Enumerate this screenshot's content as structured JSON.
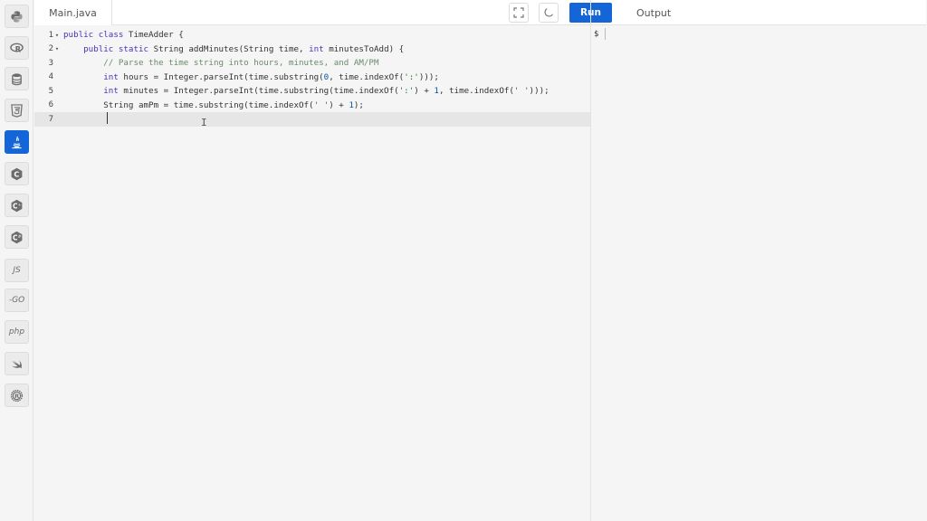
{
  "header": {
    "file_tab": "Main.java",
    "run_label": "Run",
    "output_label": "Output"
  },
  "languages": [
    {
      "name": "python",
      "label": "",
      "icon": "python-icon"
    },
    {
      "name": "r",
      "label": "",
      "icon": "r-icon"
    },
    {
      "name": "sql",
      "label": "",
      "icon": "database-icon"
    },
    {
      "name": "html",
      "label": "",
      "icon": "html5-icon"
    },
    {
      "name": "java",
      "label": "",
      "icon": "java-icon",
      "active": true
    },
    {
      "name": "c",
      "label": "",
      "icon": "c-icon"
    },
    {
      "name": "cpp",
      "label": "",
      "icon": "cpp-icon"
    },
    {
      "name": "csharp",
      "label": "",
      "icon": "csharp-icon"
    },
    {
      "name": "javascript",
      "label": "JS",
      "icon": "js-icon"
    },
    {
      "name": "go",
      "label": "-GO",
      "icon": "go-icon"
    },
    {
      "name": "php",
      "label": "php",
      "icon": "php-icon"
    },
    {
      "name": "swift",
      "label": "",
      "icon": "swift-icon"
    },
    {
      "name": "rust",
      "label": "",
      "icon": "rust-icon"
    }
  ],
  "editor": {
    "line_numbers": [
      "1",
      "2",
      "3",
      "4",
      "5",
      "6",
      "7"
    ],
    "lines": [
      "public class TimeAdder {",
      "    public static String addMinutes(String time, int minutesToAdd) {",
      "        // Parse the time string into hours, minutes, and AM/PM",
      "        int hours = Integer.parseInt(time.substring(0, time.indexOf(':')));",
      "        int minutes = Integer.parseInt(time.substring(time.indexOf(':') + 1, time.indexOf(' ')));",
      "        String amPm = time.substring(time.indexOf(' ') + 1);",
      ""
    ],
    "current_line": 7
  },
  "output": {
    "prompt": "$"
  },
  "colors": {
    "accent": "#1466d8",
    "keyword": "#4a33b8",
    "comment": "#6a8a6a",
    "string": "#1d7a3a",
    "number": "#0b55a5"
  }
}
